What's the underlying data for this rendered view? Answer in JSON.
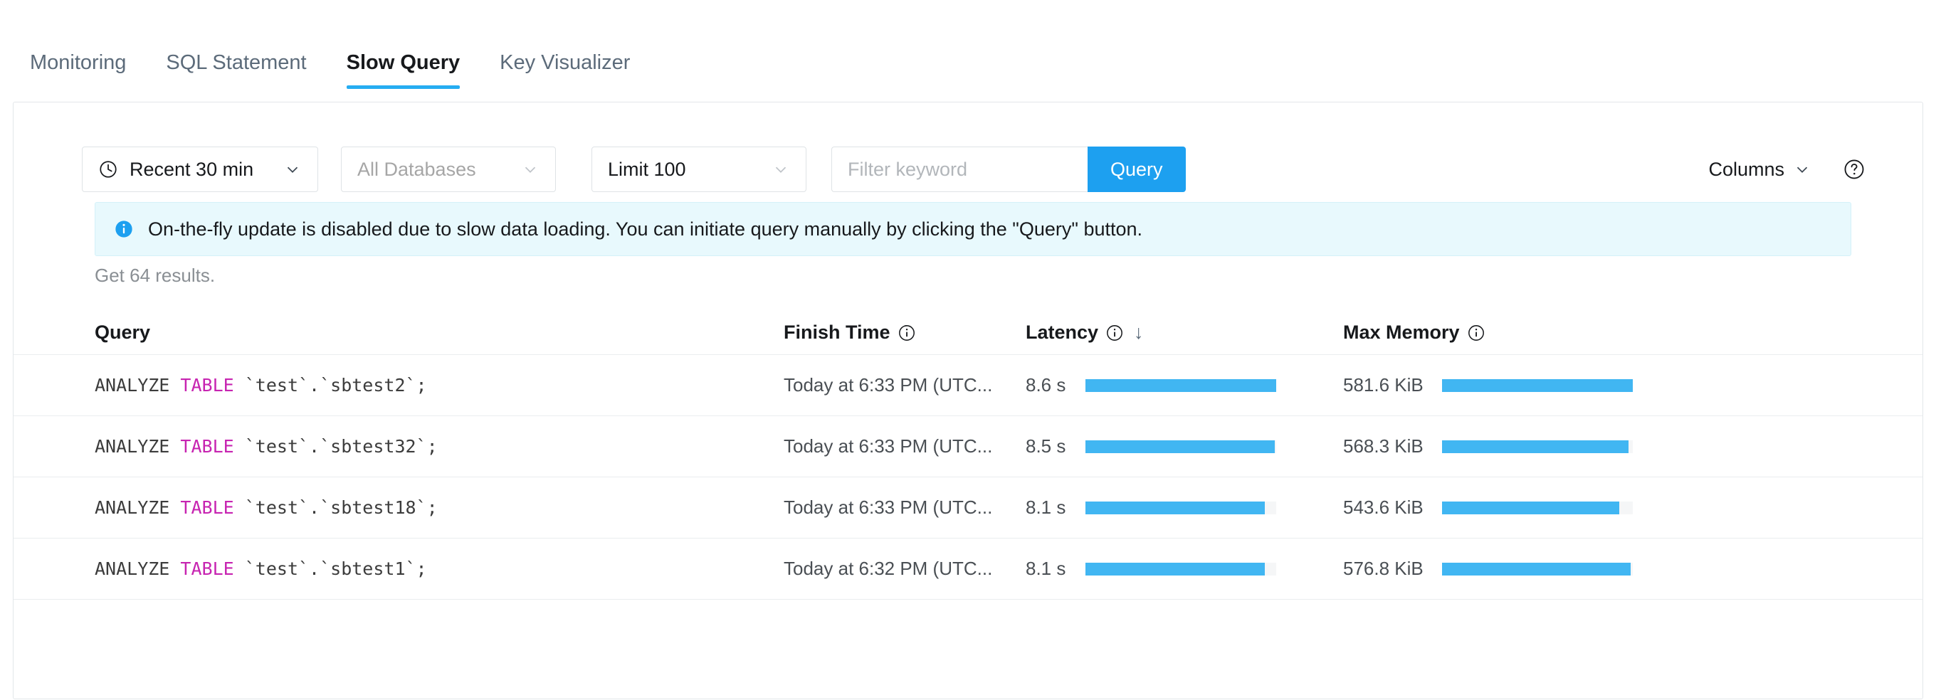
{
  "tabs": [
    {
      "label": "Monitoring",
      "active": false
    },
    {
      "label": "SQL Statement",
      "active": false
    },
    {
      "label": "Slow Query",
      "active": true
    },
    {
      "label": "Key Visualizer",
      "active": false
    }
  ],
  "toolbar": {
    "time_range": "Recent 30 min",
    "database": "All Databases",
    "limit": "Limit 100",
    "filter_placeholder": "Filter keyword",
    "filter_value": "",
    "query_button": "Query",
    "columns_button": "Columns",
    "help_icon": "question-circle-icon",
    "clock_icon": "clock-icon",
    "caret_icon": "chevron-down-icon"
  },
  "banner": {
    "icon": "info-circle-icon",
    "text": "On-the-fly update is disabled due to slow data loading. You can initiate query manually by clicking the \"Query\" button."
  },
  "results_text": "Get 64 results.",
  "table": {
    "columns": [
      {
        "label": "Query",
        "info": false,
        "sort": ""
      },
      {
        "label": "Finish Time",
        "info": true,
        "sort": ""
      },
      {
        "label": "Latency",
        "info": true,
        "sort": "↓"
      },
      {
        "label": "Max Memory",
        "info": true,
        "sort": ""
      }
    ],
    "rows": [
      {
        "sql_keyword_pre": "ANALYZE ",
        "sql_keyword": "TABLE",
        "sql_rest": " `test`.`sbtest2`;",
        "finish_time": "Today at 6:33 PM (UTC...",
        "latency": "8.6 s",
        "latency_pct": 100,
        "max_memory": "581.6 KiB",
        "memory_pct": 100
      },
      {
        "sql_keyword_pre": "ANALYZE ",
        "sql_keyword": "TABLE",
        "sql_rest": " `test`.`sbtest32`;",
        "finish_time": "Today at 6:33 PM (UTC...",
        "latency": "8.5 s",
        "latency_pct": 99,
        "max_memory": "568.3 KiB",
        "memory_pct": 98
      },
      {
        "sql_keyword_pre": "ANALYZE ",
        "sql_keyword": "TABLE",
        "sql_rest": " `test`.`sbtest18`;",
        "finish_time": "Today at 6:33 PM (UTC...",
        "latency": "8.1 s",
        "latency_pct": 94,
        "max_memory": "543.6 KiB",
        "memory_pct": 93
      },
      {
        "sql_keyword_pre": "ANALYZE ",
        "sql_keyword": "TABLE",
        "sql_rest": " `test`.`sbtest1`;",
        "finish_time": "Today at 6:32 PM (UTC...",
        "latency": "8.1 s",
        "latency_pct": 94,
        "max_memory": "576.8 KiB",
        "memory_pct": 99
      }
    ]
  },
  "colors": {
    "accent": "#1da0f0",
    "bar": "#41b6f2",
    "keyword": "#c724b1",
    "banner_bg": "#e8f9fd",
    "tab_underline": "#26adf2"
  }
}
